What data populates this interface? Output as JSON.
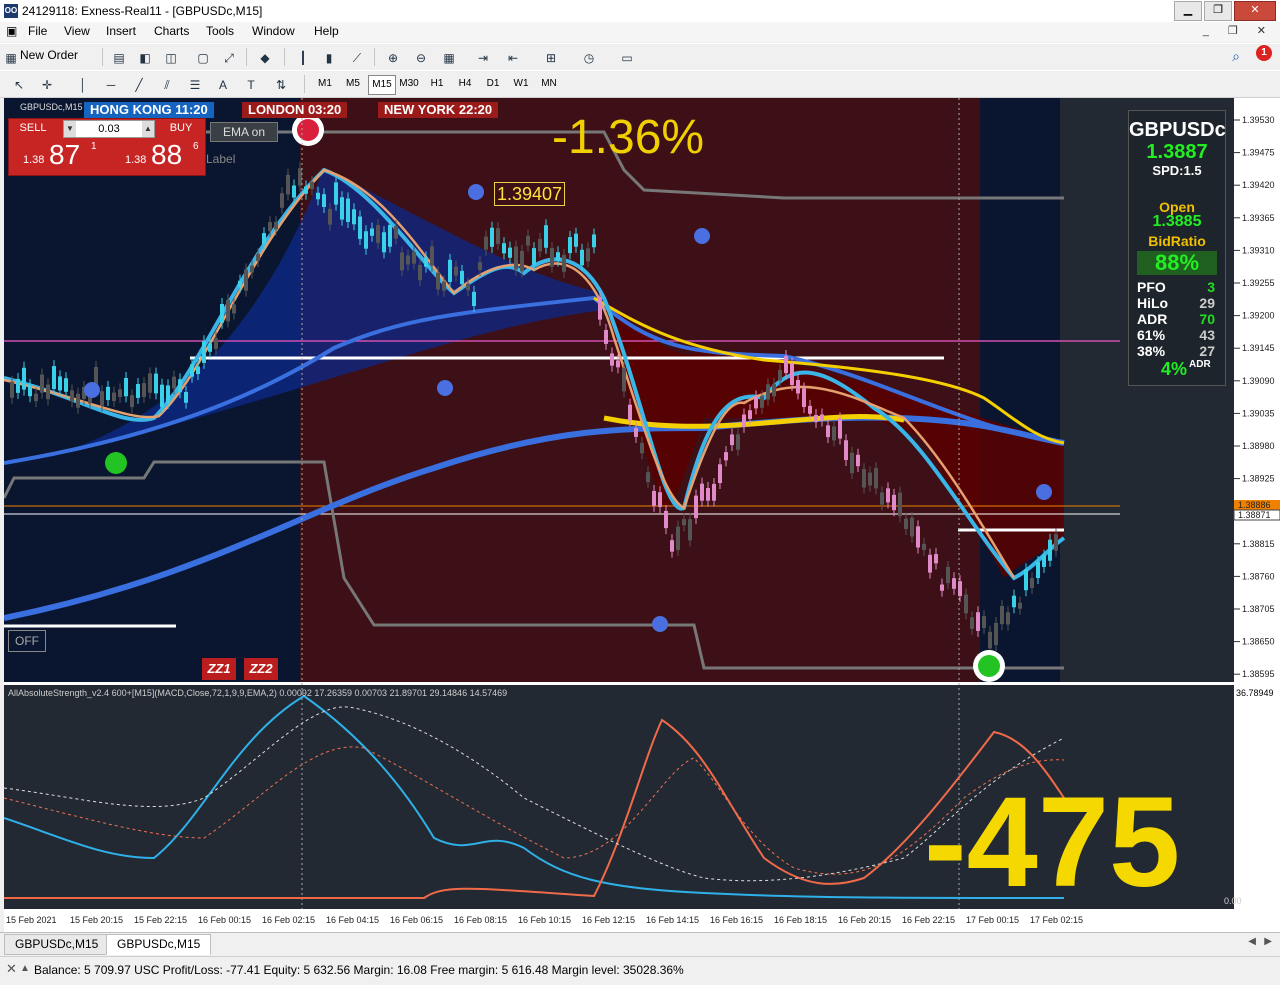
{
  "window": {
    "title": "24129118: Exness-Real11 - [GBPUSDc,M15]",
    "app_icon": "mt4-icon",
    "buttons": [
      "minimize",
      "restore",
      "close"
    ]
  },
  "menu": [
    "File",
    "View",
    "Insert",
    "Charts",
    "Tools",
    "Window",
    "Help"
  ],
  "toolbar": {
    "new_order_label": "New Order",
    "timeframes": [
      "M1",
      "M5",
      "M15",
      "M30",
      "H1",
      "H4",
      "D1",
      "W1",
      "MN"
    ],
    "active_timeframe": "M15",
    "notification_count": "1"
  },
  "chart": {
    "symbol_label": "GBPUSDc,M15",
    "sessions": [
      {
        "label": "HONG KONG 11:20",
        "color": "#1565c0"
      },
      {
        "label": "LONDON  03:20",
        "color": "#9b1b1b"
      },
      {
        "label": "NEW YORK  22:20",
        "color": "#9b1b1b"
      }
    ],
    "trade_panel": {
      "sell_label": "SELL",
      "buy_label": "BUY",
      "lot": "0.03",
      "sell_prefix": "1.38",
      "sell_big": "87",
      "sell_sup": "1",
      "buy_prefix": "1.38",
      "buy_big": "88",
      "buy_sup": "6",
      "label_text": "Label"
    },
    "ema_button": "EMA on",
    "off_button": "OFF",
    "zz1": "ZZ1",
    "zz2": "ZZ2",
    "pct_change": "-1.36%",
    "high_label": "1.39407",
    "big_number": "-475",
    "price_axis": [
      "1.39530",
      "1.39475",
      "1.39420",
      "1.39365",
      "1.39310",
      "1.39255",
      "1.39200",
      "1.39145",
      "1.39090",
      "1.39035",
      "1.38980",
      "1.38925",
      "1.38870",
      "1.38815",
      "1.38760",
      "1.38705",
      "1.38650",
      "1.38595"
    ],
    "price_tag_ask": "1.38886",
    "price_tag_bid": "1.38871",
    "info_panel": {
      "symbol": "GBPUSDc",
      "price": "1.3887",
      "spread": "SPD:1.5",
      "open_label": "Open",
      "open_value": "1.3885",
      "bidratio_label": "BidRatio",
      "bidratio_value": "88%",
      "rows": [
        {
          "k": "PFO",
          "v": "3",
          "color": "#22dd22"
        },
        {
          "k": "HiLo",
          "v": "29",
          "color": "#cccccc"
        },
        {
          "k": "ADR",
          "v": "70",
          "color": "#22dd22"
        },
        {
          "k": "61%",
          "v": "43",
          "color": "#cccccc"
        },
        {
          "k": "38%",
          "v": "27",
          "color": "#cccccc"
        }
      ],
      "adr_pct": "4%",
      "adr_sup": "ADR"
    },
    "indicator_title": "AllAbsoluteStrength_v2.4 600+[M15](MACD,Close,72,1,9,9,EMA,2) 0.00092 17.26359 0.00703 21.89701 29.14846 14.57469",
    "indicator_axis_top": "36.78949",
    "indicator_axis_bottom": "0.00",
    "time_axis": [
      "15 Feb 2021",
      "15 Feb 20:15",
      "15 Feb 22:15",
      "16 Feb 00:15",
      "16 Feb 02:15",
      "16 Feb 04:15",
      "16 Feb 06:15",
      "16 Feb 08:15",
      "16 Feb 10:15",
      "16 Feb 12:15",
      "16 Feb 14:15",
      "16 Feb 16:15",
      "16 Feb 18:15",
      "16 Feb 20:15",
      "16 Feb 22:15",
      "17 Feb 00:15",
      "17 Feb 02:15"
    ]
  },
  "tabs": [
    "GBPUSDc,M15",
    "GBPUSDc,M15"
  ],
  "active_tab": 1,
  "status": {
    "text": "Balance: 5 709.97 USC  Profit/Loss: -77.41  Equity: 5 632.56  Margin: 16.08  Free margin: 5 616.48  Margin level: 35028.36%"
  }
}
